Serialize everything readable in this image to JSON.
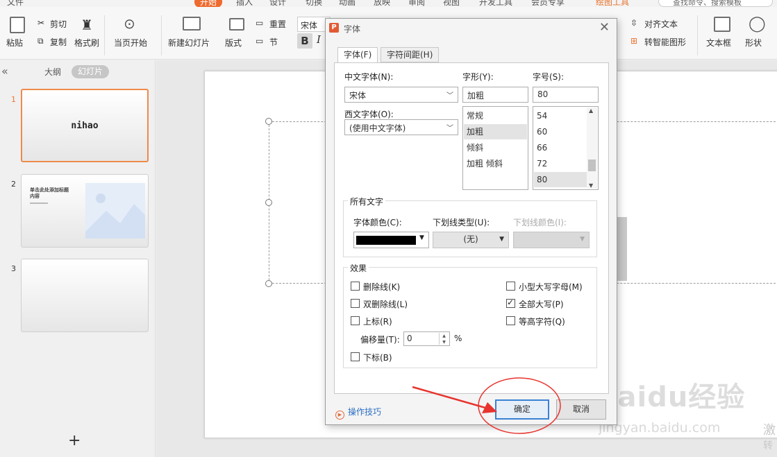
{
  "menubar": {
    "items": [
      "文件",
      "开始",
      "插入",
      "设计",
      "切换",
      "动画",
      "放映",
      "审阅",
      "视图",
      "开发工具",
      "会员专享",
      "绘图工具"
    ],
    "search": "查找命令、搜索模板"
  },
  "ribbon": {
    "paste": "粘贴",
    "cut": "剪切",
    "copy": "复制",
    "format_painter": "格式刷",
    "from_current": "当页开始",
    "new_slide": "新建幻灯片",
    "layout": "版式",
    "reset": "重置",
    "section": "节",
    "font_value": "宋体",
    "bold": "B",
    "italic": "I",
    "align_text": "对齐文本",
    "smart_shape": "转智能图形",
    "text_box": "文本框",
    "shape": "形状"
  },
  "left_panel": {
    "tab_outline": "大纲",
    "tab_slides": "幻灯片",
    "slides": [
      {
        "num": "1",
        "title": "nihao"
      },
      {
        "num": "2",
        "title": "单击此处添加标题内容"
      },
      {
        "num": "3",
        "title": ""
      }
    ]
  },
  "dialog": {
    "title": "字体",
    "tab_font": "字体(F)",
    "tab_spacing": "字符间距(H)",
    "cn_font_label": "中文字体(N):",
    "cn_font_value": "宋体",
    "style_label": "字形(Y):",
    "style_value": "加粗",
    "size_label": "字号(S):",
    "size_value": "80",
    "west_font_label": "西文字体(O):",
    "west_font_value": "(使用中文字体)",
    "style_options": [
      "常规",
      "加粗",
      "倾斜",
      "加粗 倾斜"
    ],
    "size_options": [
      "54",
      "60",
      "66",
      "72",
      "80"
    ],
    "all_text_group": "所有文字",
    "font_color_label": "字体颜色(C):",
    "font_color_value": "#000000",
    "underline_type_label": "下划线类型(U):",
    "underline_type_value": "(无)",
    "underline_color_label": "下划线颜色(I):",
    "effects_group": "效果",
    "strikethrough": "删除线(K)",
    "double_strikethrough": "双删除线(L)",
    "superscript": "上标(R)",
    "offset_label": "偏移量(T):",
    "offset_value": "0",
    "offset_unit": "%",
    "subscript": "下标(B)",
    "small_caps": "小型大写字母(M)",
    "all_caps": "全部大写(P)",
    "equal_height": "等高字符(Q)",
    "checked": {
      "strikethrough": false,
      "double_strikethrough": false,
      "superscript": false,
      "subscript": false,
      "small_caps": false,
      "all_caps": true,
      "equal_height": false
    },
    "tips": "操作技巧",
    "ok": "确定",
    "cancel": "取消"
  },
  "watermark": {
    "logo": "Baidu经验",
    "url": "jingyan.baidu.com",
    "right1": "激",
    "right2": "转"
  },
  "colors": {
    "accent": "#ef6a2e",
    "annotation": "#e8342e",
    "ok_border": "#3a82d4"
  }
}
